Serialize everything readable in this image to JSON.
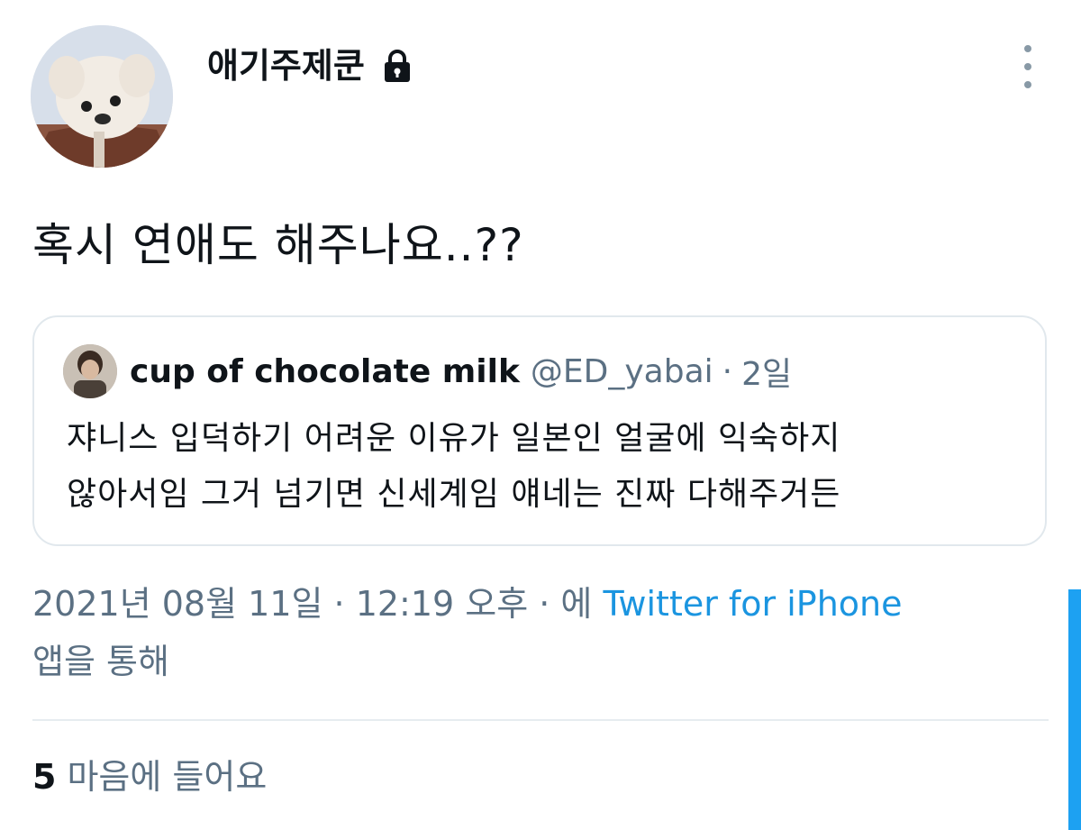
{
  "author": {
    "display_name": "애기주제쿤",
    "protected_icon": "lock-icon",
    "avatar": "avatar-icon"
  },
  "more_icon": "more-vertical-icon",
  "tweet": {
    "text": "혹시 연애도 해주나요..??"
  },
  "quoted_tweet": {
    "name": "cup of chocolate milk",
    "handle": "@ED_yabai",
    "separator": "·",
    "time": "2일",
    "lines": [
      "쟈니스 입덕하기 어려운 이유가 일본인 얼굴에 익숙하지",
      "않아서임 그거 넘기면 신세계임 얘네는 진짜 다해주거든"
    ]
  },
  "meta": {
    "datetime": "2021년 08월 11일 · 12:19 오후 · 에 ",
    "source": "Twitter for iPhone",
    "suffix": "앱을 통해"
  },
  "stats": {
    "likes_count": "5",
    "likes_label": "마음에 들어요"
  },
  "colors": {
    "text": "#0f1419",
    "secondary": "#5b7083",
    "link": "#1b95e0",
    "border": "#e1e8ed",
    "accent": "#1da1f2"
  }
}
